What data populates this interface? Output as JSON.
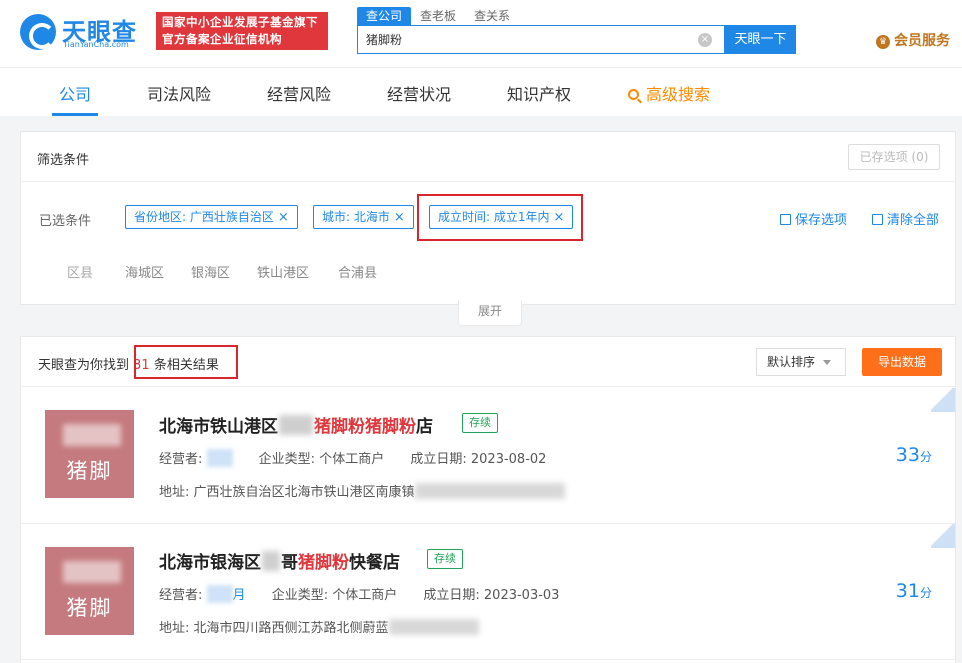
{
  "header": {
    "logo_cn": "天眼查",
    "logo_en": "TianYanCha.com",
    "banner_line1": "国家中小企业发展子基金旗下",
    "banner_line2": "官方备案企业征信机构",
    "search_tabs": [
      "查公司",
      "查老板",
      "查关系"
    ],
    "search_value": "猪脚粉",
    "search_button": "天眼一下",
    "vip_label": "会员服务"
  },
  "nav": {
    "items": [
      "公司",
      "司法风险",
      "经营风险",
      "经营状况",
      "知识产权"
    ],
    "advanced": "高级搜索"
  },
  "filter": {
    "title": "筛选条件",
    "saved_options": "已存选项 (0)",
    "selected_label": "已选条件",
    "tags": [
      "省份地区: 广西壮族自治区",
      "城市: 北海市",
      "成立时间: 成立1年内"
    ],
    "save_option": "保存选项",
    "clear_all": "清除全部",
    "district_label": "区县",
    "districts": [
      "海城区",
      "银海区",
      "铁山港区",
      "合浦县"
    ],
    "expand": "展开"
  },
  "results": {
    "prefix": "天眼查为你找到",
    "count": "31",
    "suffix": "条相关结果",
    "sort": "默认排序",
    "export": "导出数据",
    "items": [
      {
        "logo_text": "猪脚",
        "name_prefix": "北海市铁山港区",
        "name_highlight": "猪脚粉猪脚粉",
        "name_suffix": "店",
        "status": "存续",
        "operator_label": "经营者:",
        "type_label": "企业类型:",
        "type_value": "个体工商户",
        "date_label": "成立日期:",
        "date_value": "2023-08-02",
        "address_label": "地址:",
        "address_value": "广西壮族自治区北海市铁山港区南康镇",
        "score": "33",
        "score_unit": "分"
      },
      {
        "logo_text": "猪脚",
        "name_prefix": "北海市银海区",
        "name_mid": "哥",
        "name_highlight": "猪脚粉",
        "name_suffix": "快餐店",
        "status": "存续",
        "operator_label": "经营者:",
        "operator_tail": "月",
        "type_label": "企业类型:",
        "type_value": "个体工商户",
        "date_label": "成立日期:",
        "date_value": "2023-03-03",
        "address_label": "地址:",
        "address_value": "北海市四川路西侧江苏路北侧蔚蓝",
        "score": "31",
        "score_unit": "分"
      }
    ]
  },
  "colors": {
    "brand": "#1f87e6",
    "highlight_red": "#e0373d",
    "annotation_red": "#d9252c",
    "export_orange": "#ff6f1a",
    "status_green": "#22a35a",
    "vip_gold": "#c0751e"
  }
}
